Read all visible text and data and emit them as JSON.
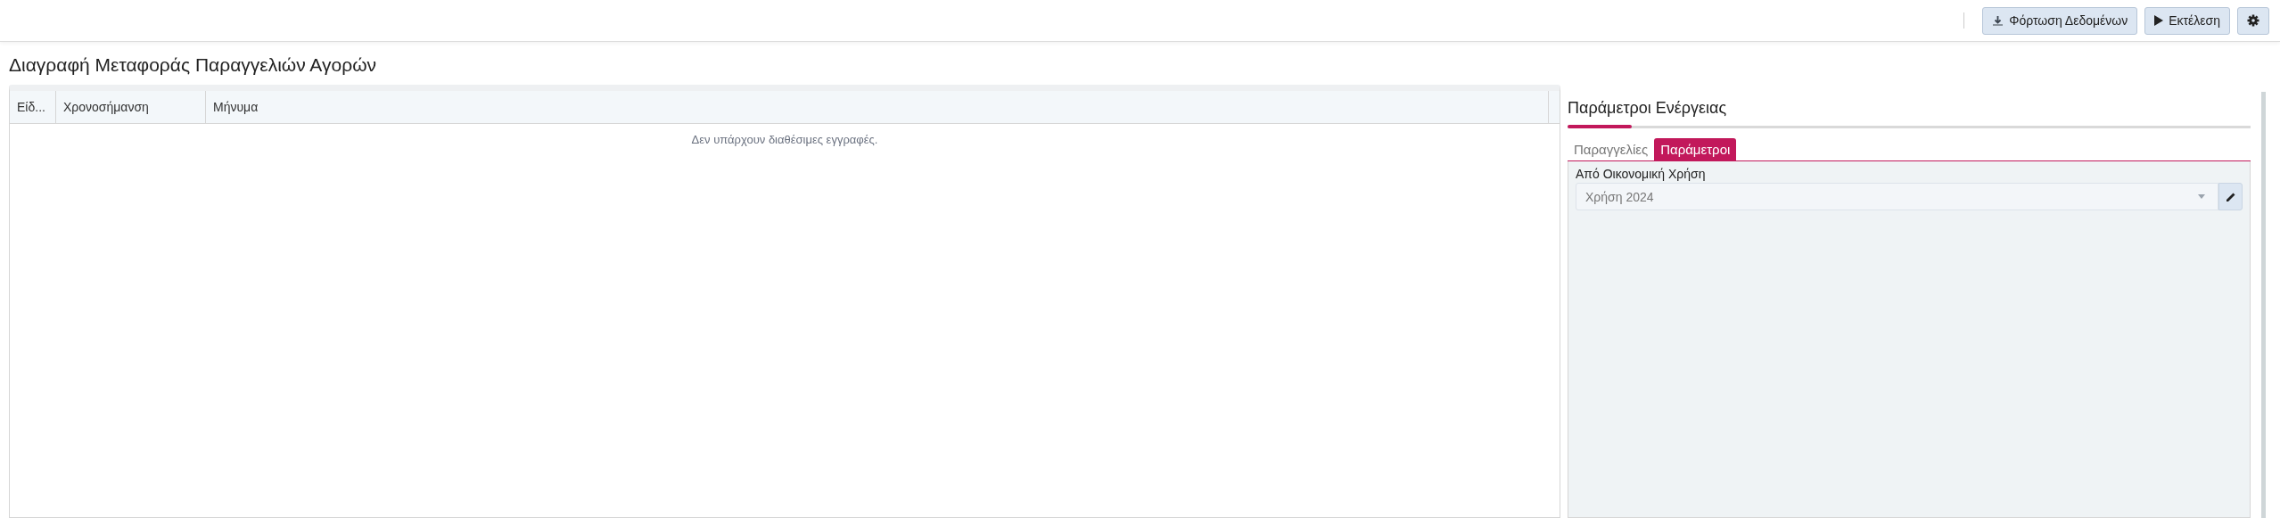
{
  "toolbar": {
    "buttons": [
      {
        "kind": "download",
        "label": "Φόρτωση Δεδομένων"
      },
      {
        "kind": "play",
        "label": "Εκτέλεση"
      },
      {
        "kind": "settings"
      }
    ]
  },
  "page_title": "Διαγραφή Μεταφοράς Παραγγελιών Αγορών",
  "table": {
    "columns": [
      "Είδ...",
      "Χρονοσήμανση",
      "Μήνυμα"
    ],
    "empty_message": "Δεν υπάρχουν διαθέσιμες εγγραφές."
  },
  "side_panel": {
    "title": "Παράμετροι Ενέργειας",
    "tabs": [
      {
        "label": "Παραγγελίες",
        "selected": false
      },
      {
        "label": "Παράμετροι",
        "selected": true
      }
    ],
    "fields": [
      {
        "label": "Από Οικονομική Χρήση",
        "value": "Χρήση 2024"
      }
    ]
  }
}
